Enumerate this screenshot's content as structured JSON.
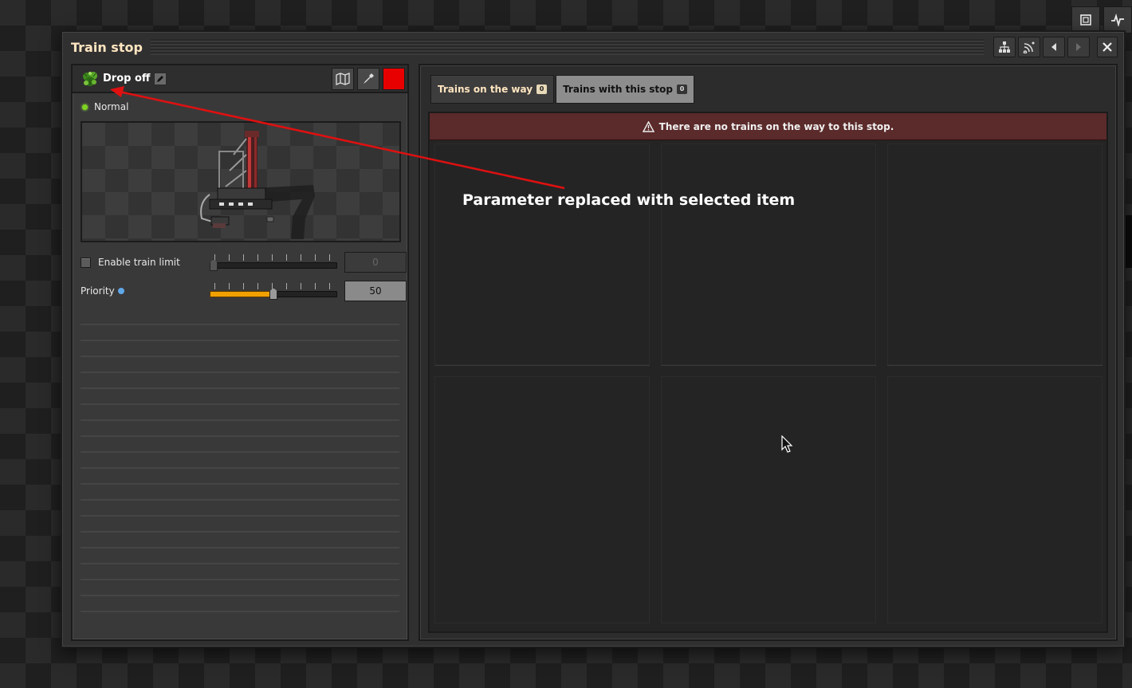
{
  "window": {
    "title": "Train stop",
    "title_buttons": [
      "network-icon",
      "signal-icon",
      "arrow-left-icon",
      "arrow-right-icon"
    ],
    "close_icon": "close-icon"
  },
  "top_toolbar": {
    "buttons": [
      "map-select-icon",
      "pulse-icon"
    ]
  },
  "stop": {
    "name": "Drop off",
    "icon": "parameter-plant-icon",
    "buttons": [
      "map-icon",
      "eyedropper-icon"
    ],
    "color": "#e80000",
    "status": "Normal",
    "status_color": "#7ed321"
  },
  "train_limit": {
    "label": "Enable train limit",
    "checked": false,
    "value": "0",
    "slider_fraction": 0
  },
  "priority": {
    "label": "Priority",
    "value": "50",
    "slider_fraction": 0.5
  },
  "tabs": [
    {
      "label": "Trains on the way",
      "count": "0",
      "active": true
    },
    {
      "label": "Trains with this stop",
      "count": "0",
      "active": false
    }
  ],
  "warning": {
    "icon": "warning-icon",
    "text": "There are no trains on the way to this stop."
  },
  "annotation": {
    "text": "Parameter replaced with selected item",
    "color": "#e01010"
  }
}
